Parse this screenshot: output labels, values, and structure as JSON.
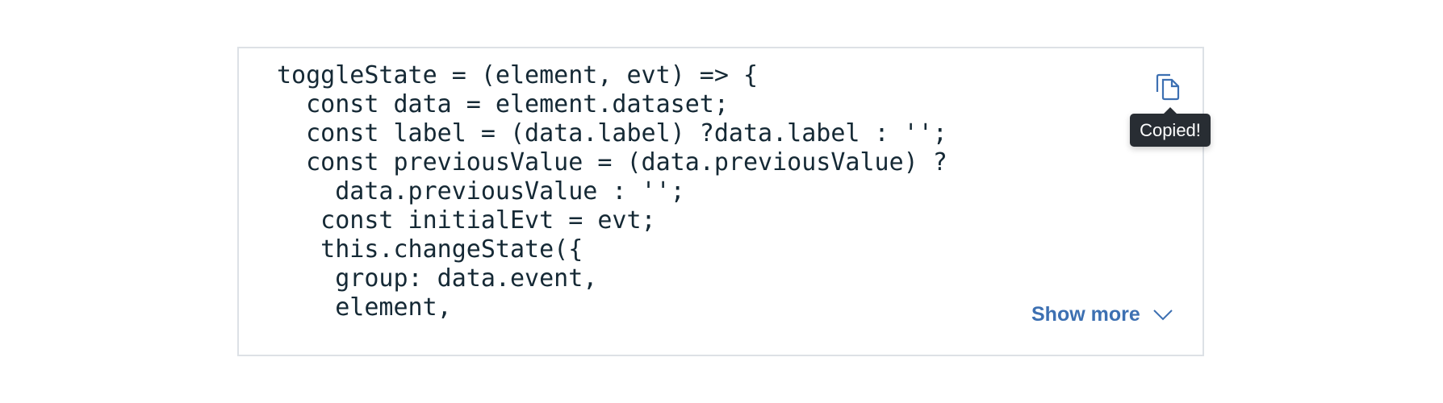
{
  "code_snippet": {
    "lines": [
      "toggleState = (element, evt) => {",
      "  const data = element.dataset;",
      "  const label = (data.label) ?data.label : '';",
      "  const previousValue = (data.previousValue) ?",
      "    data.previousValue : '';",
      "   const initialEvt = evt;",
      "   this.changeState({",
      "    group: data.event,",
      "    element,"
    ],
    "copy_icon": "copy-icon",
    "tooltip": "Copied!",
    "show_more_label": "Show more",
    "chevron_icon": "chevron-down-icon",
    "accent_color": "#3d70b2"
  }
}
